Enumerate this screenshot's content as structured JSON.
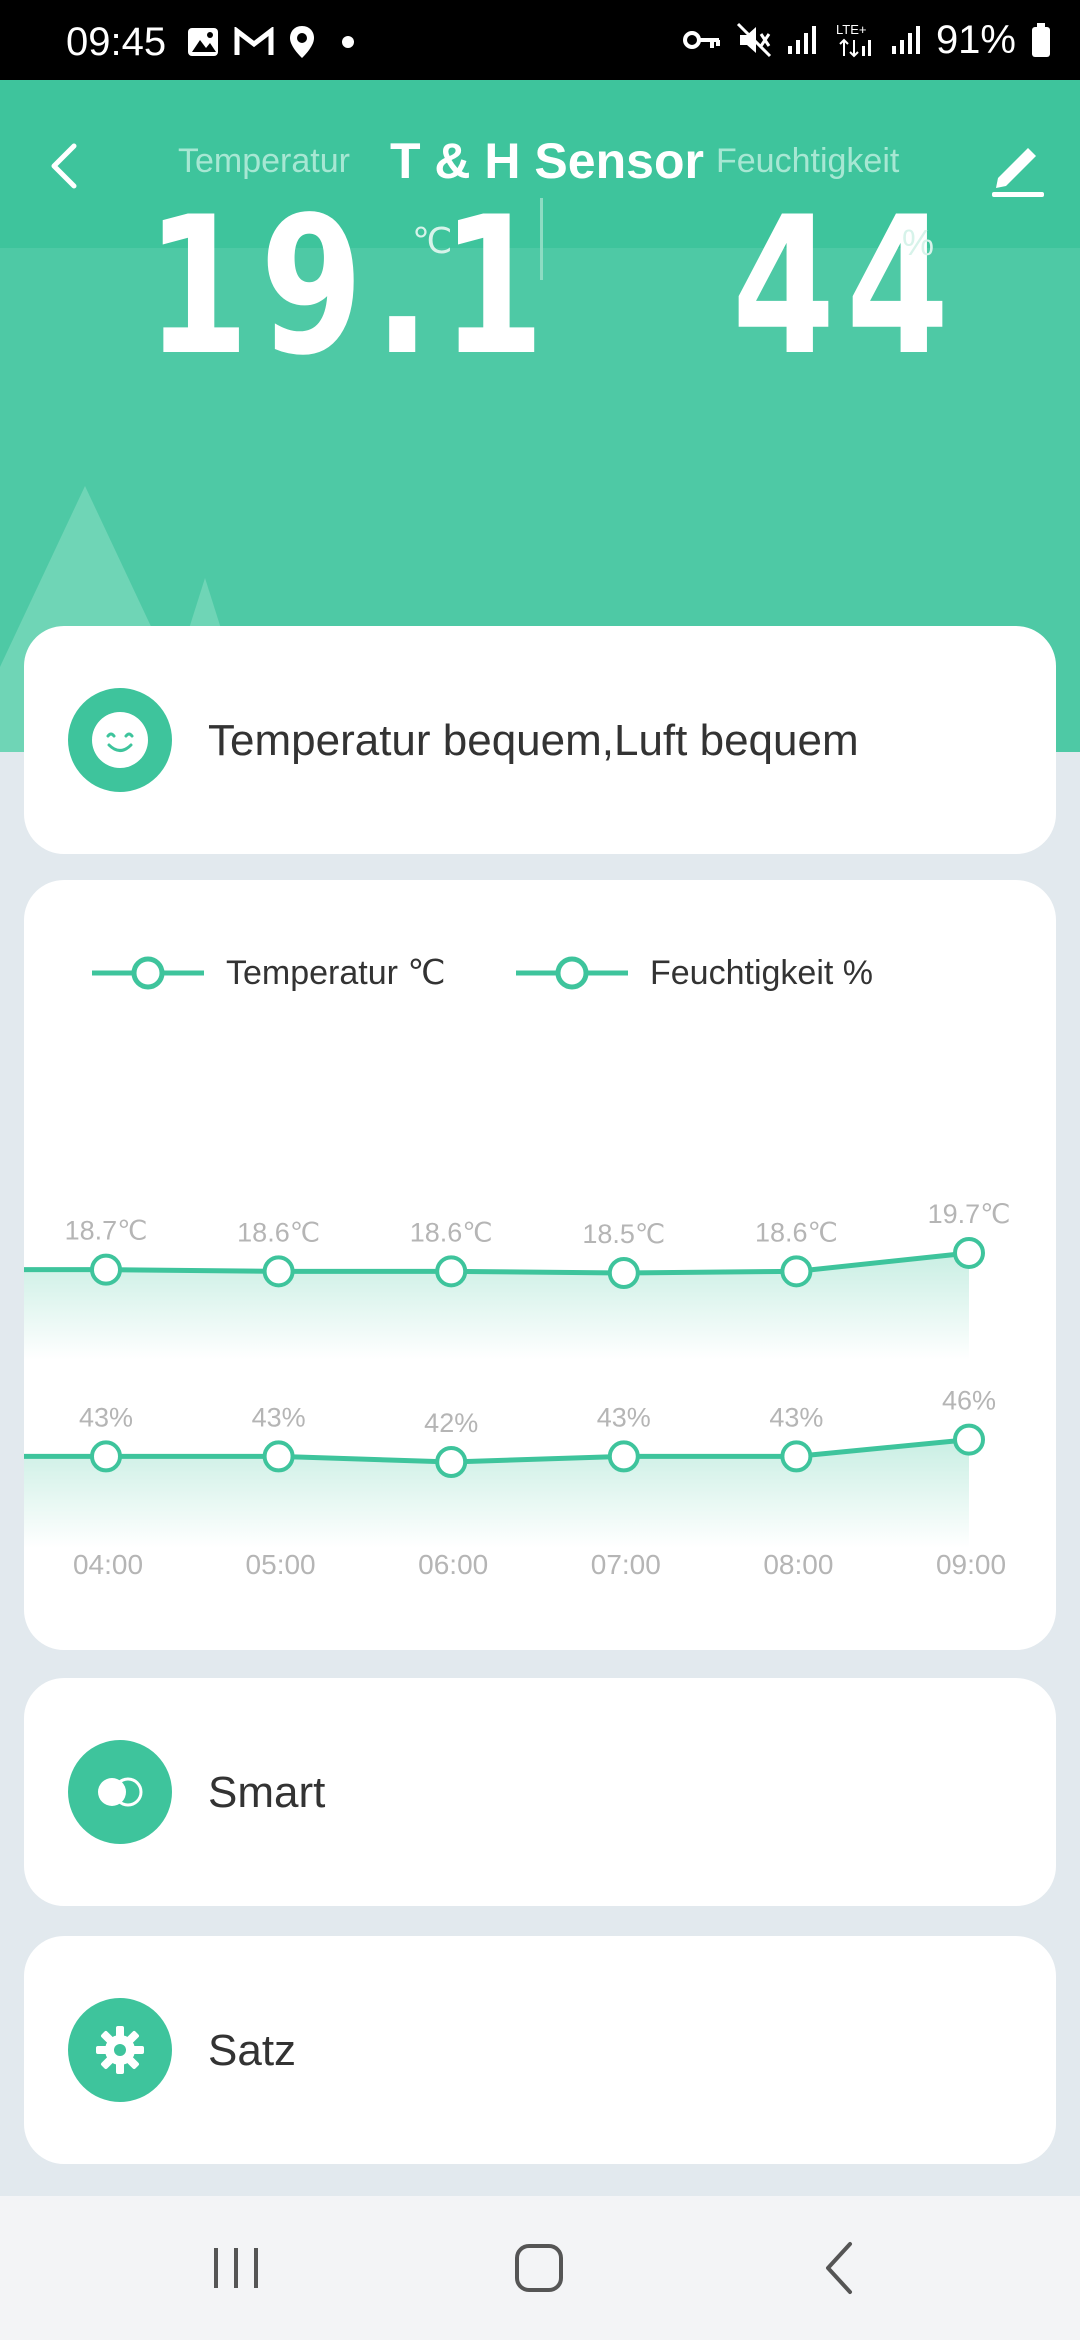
{
  "status_bar": {
    "time": "09:45",
    "battery": "91%",
    "icons": [
      "image-icon",
      "gmail-icon",
      "location-icon",
      "dot-icon",
      "vpn-key-icon",
      "mute-icon",
      "signal-icon",
      "lte-icon",
      "signal-icon",
      "battery-icon"
    ]
  },
  "header": {
    "title": "T & H Sensor",
    "temp_label": "Temperatur",
    "humidity_label": "Feuchtigkeit",
    "temp_value": "19.1",
    "temp_unit": "℃",
    "humidity_value": "44",
    "humidity_unit": "%",
    "bg_color": "#3ec49c"
  },
  "comfort": {
    "text": "Temperatur bequem,Luft bequem",
    "icon": "smile-icon"
  },
  "chart_data": {
    "type": "line",
    "x": [
      "04:00",
      "05:00",
      "06:00",
      "07:00",
      "08:00",
      "09:00"
    ],
    "series": [
      {
        "name": "Temperatur ℃",
        "values": [
          18.7,
          18.6,
          18.6,
          18.5,
          18.6,
          19.7
        ],
        "labels": [
          "18.7℃",
          "18.6℃",
          "18.6℃",
          "18.5℃",
          "18.6℃",
          "19.7℃"
        ]
      },
      {
        "name": "Feuchtigkeit %",
        "values": [
          43,
          43,
          42,
          43,
          43,
          46
        ],
        "labels": [
          "43%",
          "43%",
          "42%",
          "43%",
          "43%",
          "46%"
        ]
      }
    ],
    "line_color": "#3ec49c"
  },
  "menu": {
    "smart_label": "Smart",
    "settings_label": "Satz"
  }
}
